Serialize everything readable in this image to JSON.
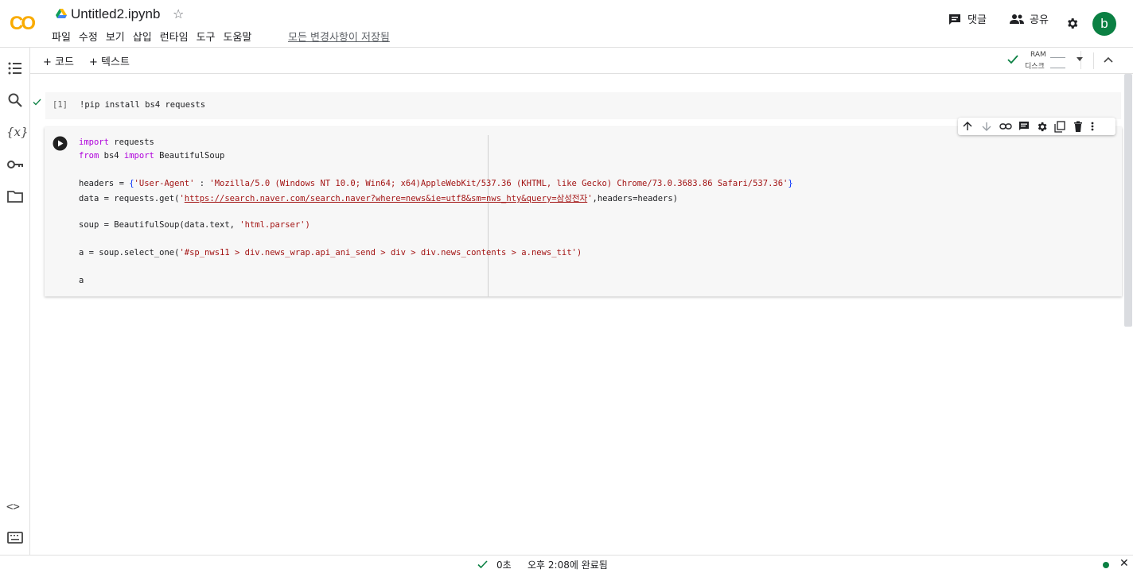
{
  "app": {
    "logo_text": "CO",
    "notebook_title": "Untitled2.ipynb",
    "save_status": "모든 변경사항이 저장됨"
  },
  "menu": [
    "파일",
    "수정",
    "보기",
    "삽입",
    "런타임",
    "도구",
    "도움말"
  ],
  "header_actions": {
    "comment_label": "댓글",
    "share_label": "공유",
    "avatar_letter": "b"
  },
  "toolbar": {
    "add_code": "+ 코드",
    "add_text": "+ 텍스트",
    "ram_label": "RAM",
    "disk_label": "디스크"
  },
  "cells": {
    "cell1": {
      "exec_count": "[1]",
      "code": "!pip install bs4 requests"
    },
    "cell2": {
      "line1_kw": "import",
      "line1_rest": " requests",
      "line2_kw1": "from",
      "line2_mid": " bs4 ",
      "line2_kw2": "import",
      "line2_rest": " BeautifulSoup",
      "line4_a": "headers = ",
      "line4_brace_open": "{",
      "line4_key": "'User-Agent'",
      "line4_colon": " : ",
      "line4_val": "'Mozilla/5.0 (Windows NT 10.0; Win64; x64)AppleWebKit/537.36 (KHTML, like Gecko) Chrome/73.0.3683.86 Safari/537.36'",
      "line4_brace_close": "}",
      "line5_a": "data = requests.get(",
      "line5_q1": "'",
      "line5_url": "https://search.naver.com/search.naver?where=news&ie=utf8&sm=nws_hty&query=삼성전자",
      "line5_q2": "'",
      "line5_rest": ",headers=headers)",
      "line7_a": "soup = BeautifulSoup(data.text, ",
      "line7_str": "'html.parser'",
      "line7_end": ")",
      "line9_a": "a = soup.select_one(",
      "line9_str": "'#sp_nws11 > div.news_wrap.api_ani_send > div > div.news_contents > a.news_tit'",
      "line9_end": ")",
      "line11": "a"
    }
  },
  "status": {
    "duration": "0초",
    "completed": "오후 2:08에 완료됨"
  },
  "colors": {
    "accent_green": "#0b8043",
    "logo_orange": "#f9ab00",
    "keyword": "#af00db",
    "string": "#a31515"
  }
}
